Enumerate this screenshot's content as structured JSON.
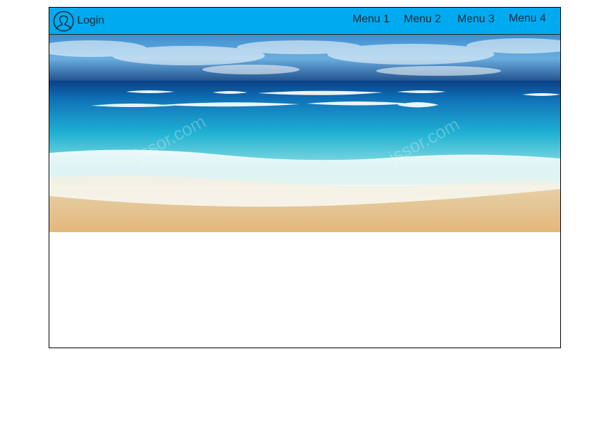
{
  "header": {
    "login_label": "Login",
    "login_icon": "user-icon",
    "menu": [
      {
        "label": "Menu 1"
      },
      {
        "label": "Menu 2"
      },
      {
        "label": "Menu 3"
      },
      {
        "label": "Menu 4"
      }
    ]
  },
  "slider": {
    "image": "beach-image",
    "watermarks": [
      "jssor.com",
      "jssor.com"
    ]
  },
  "colors": {
    "navbar": "#00aaf0",
    "sky": "#2f7fc1",
    "sea": "#1fa3c9",
    "sand": "#e9c995"
  }
}
